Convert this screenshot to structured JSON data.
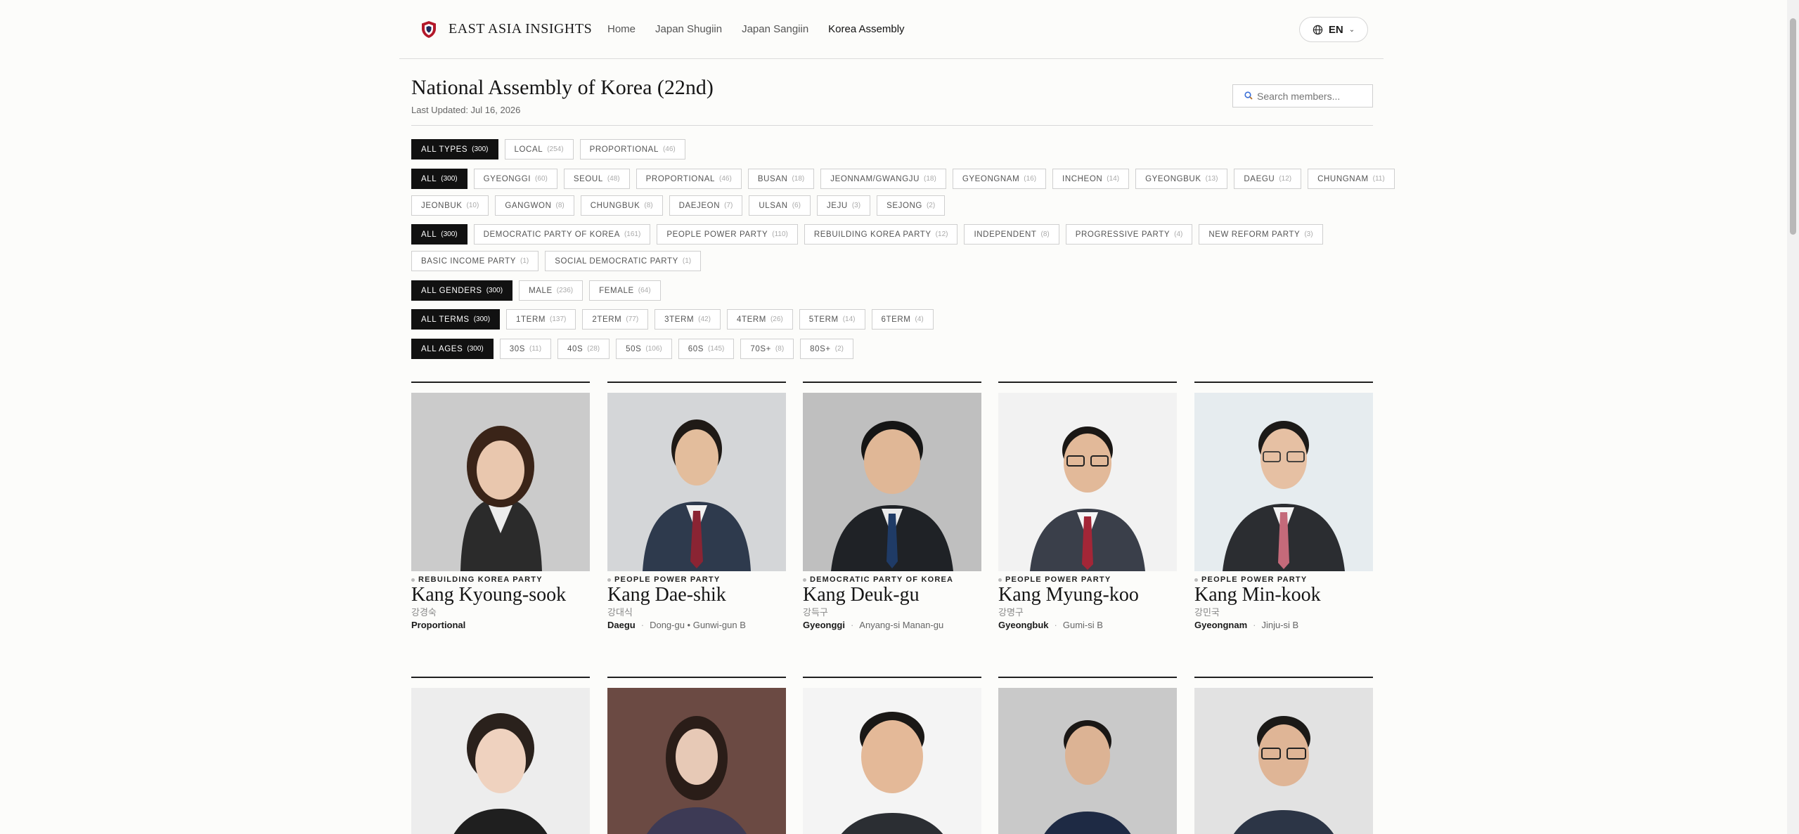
{
  "header": {
    "brand": "EAST ASIA INSIGHTS",
    "nav": [
      "Home",
      "Japan Shugiin",
      "Japan Sangiin",
      "Korea Assembly"
    ],
    "active_nav": "Korea Assembly",
    "lang": "EN"
  },
  "page": {
    "title": "National Assembly of Korea (22nd)",
    "updated": "Last Updated: Jul 16, 2026",
    "search_placeholder": "Search members..."
  },
  "filters": {
    "types": [
      {
        "label": "ALL TYPES",
        "count": "(300)",
        "active": true
      },
      {
        "label": "LOCAL",
        "count": "(254)"
      },
      {
        "label": "PROPORTIONAL",
        "count": "(46)"
      }
    ],
    "regions_row1": [
      {
        "label": "ALL",
        "count": "(300)",
        "active": true
      },
      {
        "label": "GYEONGGI",
        "count": "(60)"
      },
      {
        "label": "SEOUL",
        "count": "(48)"
      },
      {
        "label": "PROPORTIONAL",
        "count": "(46)"
      },
      {
        "label": "BUSAN",
        "count": "(18)"
      },
      {
        "label": "JEONNAM/GWANGJU",
        "count": "(18)"
      },
      {
        "label": "GYEONGNAM",
        "count": "(16)"
      },
      {
        "label": "INCHEON",
        "count": "(14)"
      },
      {
        "label": "GYEONGBUK",
        "count": "(13)"
      },
      {
        "label": "DAEGU",
        "count": "(12)"
      },
      {
        "label": "CHUNGNAM",
        "count": "(11)"
      }
    ],
    "regions_row2": [
      {
        "label": "JEONBUK",
        "count": "(10)"
      },
      {
        "label": "GANGWON",
        "count": "(8)"
      },
      {
        "label": "CHUNGBUK",
        "count": "(8)"
      },
      {
        "label": "DAEJEON",
        "count": "(7)"
      },
      {
        "label": "ULSAN",
        "count": "(6)"
      },
      {
        "label": "JEJU",
        "count": "(3)"
      },
      {
        "label": "SEJONG",
        "count": "(2)"
      }
    ],
    "parties_row1": [
      {
        "label": "ALL",
        "count": "(300)",
        "active": true
      },
      {
        "label": "DEMOCRATIC PARTY OF KOREA",
        "count": "(161)"
      },
      {
        "label": "PEOPLE POWER PARTY",
        "count": "(110)"
      },
      {
        "label": "REBUILDING KOREA PARTY",
        "count": "(12)"
      },
      {
        "label": "INDEPENDENT",
        "count": "(8)"
      },
      {
        "label": "PROGRESSIVE PARTY",
        "count": "(4)"
      },
      {
        "label": "NEW REFORM PARTY",
        "count": "(3)"
      }
    ],
    "parties_row2": [
      {
        "label": "BASIC INCOME PARTY",
        "count": "(1)"
      },
      {
        "label": "SOCIAL DEMOCRATIC PARTY",
        "count": "(1)"
      }
    ],
    "genders": [
      {
        "label": "ALL GENDERS",
        "count": "(300)",
        "active": true
      },
      {
        "label": "MALE",
        "count": "(236)"
      },
      {
        "label": "FEMALE",
        "count": "(64)"
      }
    ],
    "terms": [
      {
        "label": "ALL TERMS",
        "count": "(300)",
        "active": true
      },
      {
        "label": "1TERM",
        "count": "(137)"
      },
      {
        "label": "2TERM",
        "count": "(77)"
      },
      {
        "label": "3TERM",
        "count": "(42)"
      },
      {
        "label": "4TERM",
        "count": "(26)"
      },
      {
        "label": "5TERM",
        "count": "(14)"
      },
      {
        "label": "6TERM",
        "count": "(4)"
      }
    ],
    "ages": [
      {
        "label": "ALL AGES",
        "count": "(300)",
        "active": true
      },
      {
        "label": "30S",
        "count": "(11)"
      },
      {
        "label": "40S",
        "count": "(28)"
      },
      {
        "label": "50S",
        "count": "(106)"
      },
      {
        "label": "60S",
        "count": "(145)"
      },
      {
        "label": "70S+",
        "count": "(8)"
      },
      {
        "label": "80S+",
        "count": "(2)"
      }
    ]
  },
  "members": [
    {
      "party": "REBUILDING KOREA PARTY",
      "name": "Kang Kyoung-sook",
      "hangul": "강경숙",
      "region": "Proportional",
      "district": ""
    },
    {
      "party": "PEOPLE POWER PARTY",
      "name": "Kang Dae-shik",
      "hangul": "강대식",
      "region": "Daegu",
      "district": "Dong-gu • Gunwi-gun B"
    },
    {
      "party": "DEMOCRATIC PARTY OF KOREA",
      "name": "Kang Deuk-gu",
      "hangul": "강득구",
      "region": "Gyeonggi",
      "district": "Anyang-si Manan-gu"
    },
    {
      "party": "PEOPLE POWER PARTY",
      "name": "Kang Myung-koo",
      "hangul": "강명구",
      "region": "Gyeongbuk",
      "district": "Gumi-si B"
    },
    {
      "party": "PEOPLE POWER PARTY",
      "name": "Kang Min-kook",
      "hangul": "강민국",
      "region": "Gyeongnam",
      "district": "Jinju-si B"
    }
  ]
}
